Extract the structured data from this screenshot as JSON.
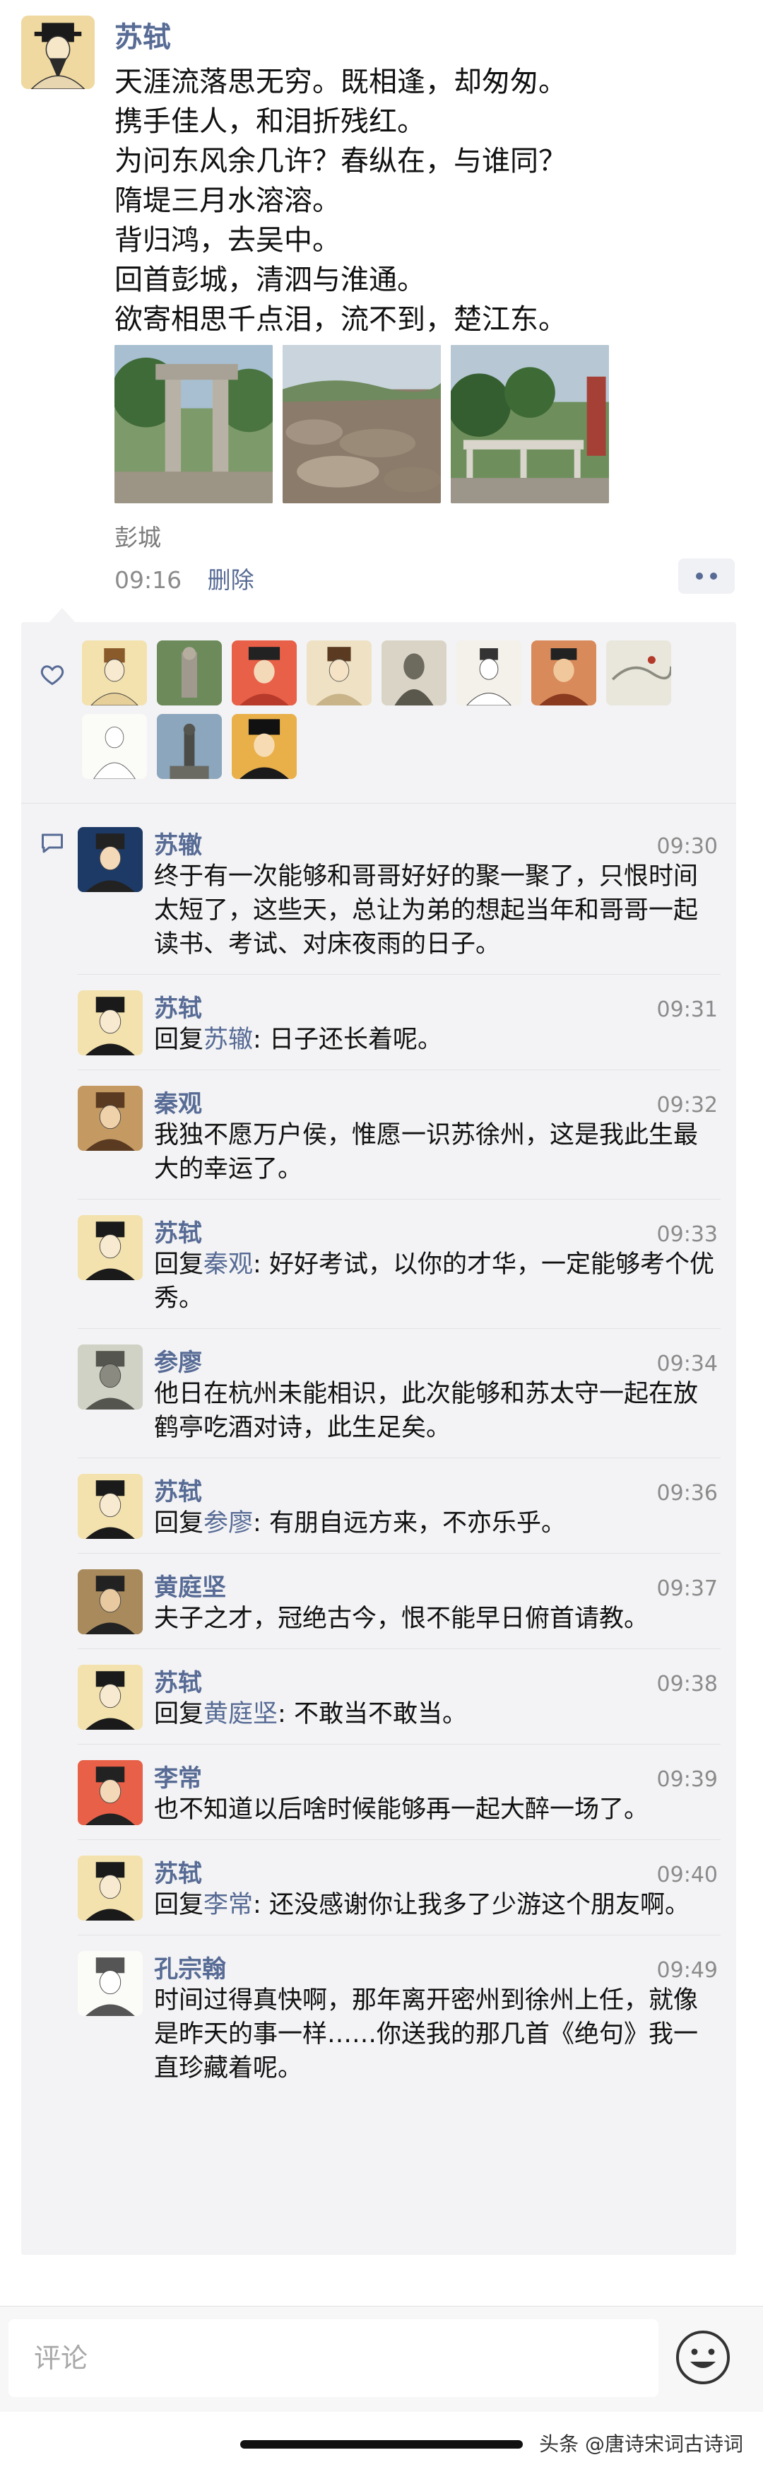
{
  "post": {
    "author": "苏轼",
    "lines": [
      "天涯流落思无穷。既相逢，却匆匆。",
      "携手佳人，和泪折残红。",
      "为问东风余几许？春纵在，与谁同？",
      "隋堤三月水溶溶。",
      "背归鸿，去吴中。",
      "回首彭城，清泗与淮通。",
      "欲寄相思千点泪，流不到，楚江东。"
    ],
    "location": "彭城",
    "time": "09:16",
    "delete_label": "删除"
  },
  "comments": [
    {
      "name": "苏辙",
      "time": "09:30",
      "reply_prefix": "",
      "reply_to": "",
      "reply_sep": "",
      "text": "终于有一次能够和哥哥好好的聚一聚了，只恨时间太短了，这些天，总让为弟的想起当年和哥哥一起读书、考试、对床夜雨的日子。"
    },
    {
      "name": "苏轼",
      "time": "09:31",
      "reply_prefix": "回复",
      "reply_to": "苏辙",
      "reply_sep": ": ",
      "text": "日子还长着呢。"
    },
    {
      "name": "秦观",
      "time": "09:32",
      "reply_prefix": "",
      "reply_to": "",
      "reply_sep": "",
      "text": "我独不愿万户侯，惟愿一识苏徐州，这是我此生最大的幸运了。"
    },
    {
      "name": "苏轼",
      "time": "09:33",
      "reply_prefix": "回复",
      "reply_to": "秦观",
      "reply_sep": ": ",
      "text": "好好考试，以你的才华，一定能够考个优秀。"
    },
    {
      "name": "参廖",
      "time": "09:34",
      "reply_prefix": "",
      "reply_to": "",
      "reply_sep": "",
      "text": "他日在杭州未能相识，此次能够和苏太守一起在放鹤亭吃酒对诗，此生足矣。"
    },
    {
      "name": "苏轼",
      "time": "09:36",
      "reply_prefix": "回复",
      "reply_to": "参廖",
      "reply_sep": ": ",
      "text": "有朋自远方来，不亦乐乎。"
    },
    {
      "name": "黄庭坚",
      "time": "09:37",
      "reply_prefix": "",
      "reply_to": "",
      "reply_sep": "",
      "text": "夫子之才，冠绝古今，恨不能早日俯首请教。"
    },
    {
      "name": "苏轼",
      "time": "09:38",
      "reply_prefix": "回复",
      "reply_to": "黄庭坚",
      "reply_sep": ": ",
      "text": "不敢当不敢当。"
    },
    {
      "name": "李常",
      "time": "09:39",
      "reply_prefix": "",
      "reply_to": "",
      "reply_sep": "",
      "text": "也不知道以后啥时候能够再一起大醉一场了。"
    },
    {
      "name": "苏轼",
      "time": "09:40",
      "reply_prefix": "回复",
      "reply_to": "李常",
      "reply_sep": ": ",
      "text": "还没感谢你让我多了少游这个朋友啊。"
    },
    {
      "name": "孔宗翰",
      "time": "09:49",
      "reply_prefix": "",
      "reply_to": "",
      "reply_sep": "",
      "text": "时间过得真快啊，那年离开密州到徐州上任，就像是昨天的事一样……你送我的那几首《绝句》我一直珍藏着呢。"
    }
  ],
  "input": {
    "placeholder": "评论"
  },
  "watermark": "头条 @唐诗宋词古诗词",
  "colors": {
    "name_link": "#576b95",
    "panel_bg": "#f3f3f5"
  }
}
